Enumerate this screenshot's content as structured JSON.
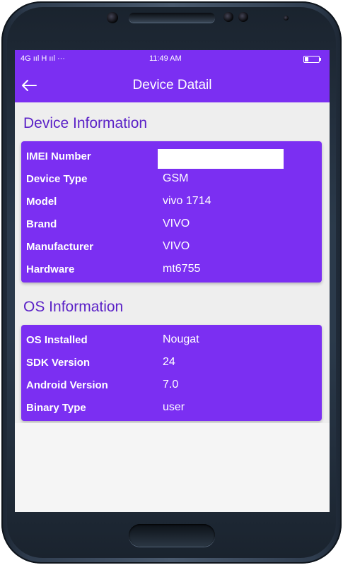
{
  "status_bar": {
    "left": "4G ııl H ııl ···",
    "time": "11:49 AM"
  },
  "toolbar": {
    "title": "Device Datail",
    "back_icon": "back-arrow-icon"
  },
  "device_section": {
    "title": "Device Information",
    "rows": [
      {
        "label": "IMEI Number",
        "value": ""
      },
      {
        "label": "Device Type",
        "value": "GSM"
      },
      {
        "label": "Model",
        "value": "vivo 1714"
      },
      {
        "label": "Brand",
        "value": "VIVO"
      },
      {
        "label": "Manufacturer",
        "value": "VIVO"
      },
      {
        "label": "Hardware",
        "value": "mt6755"
      }
    ]
  },
  "os_section": {
    "title": "OS Information",
    "rows": [
      {
        "label": "OS Installed",
        "value": "Nougat"
      },
      {
        "label": "SDK Version",
        "value": "24"
      },
      {
        "label": "Android Version",
        "value": "7.0"
      },
      {
        "label": "Binary Type",
        "value": "user"
      }
    ]
  },
  "colors": {
    "accent": "#7b2ff2",
    "section_title": "#5b22c7",
    "background": "#eeeeee"
  }
}
